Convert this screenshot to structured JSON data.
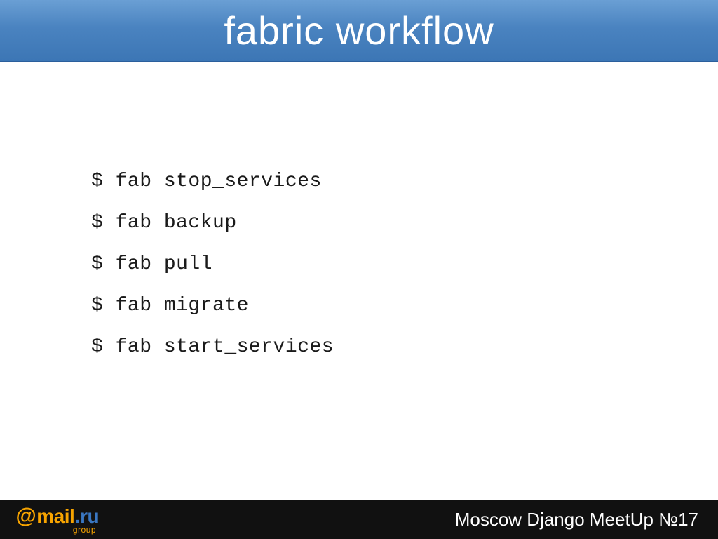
{
  "header": {
    "title": "fabric workflow"
  },
  "commands": [
    "$ fab stop_services",
    "$ fab backup",
    "$ fab pull",
    "$ fab migrate",
    "$ fab start_services"
  ],
  "footer": {
    "logo": {
      "at": "@",
      "mail": "mail",
      "dot": ".",
      "ru": "ru",
      "group": "group"
    },
    "event": "Moscow Django MeetUp №17"
  }
}
